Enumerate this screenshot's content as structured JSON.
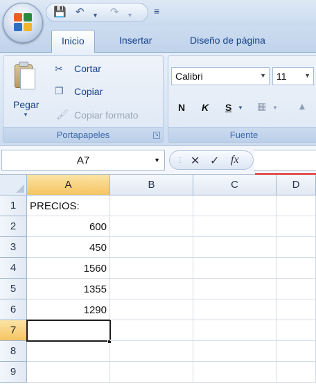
{
  "ribbon_tabs": [
    {
      "label": "Inicio",
      "active": true
    },
    {
      "label": "Insertar",
      "active": false
    },
    {
      "label": "Diseño de página",
      "active": false
    }
  ],
  "clipboard_group": {
    "paste_label": "Pegar",
    "cut_label": "Cortar",
    "copy_label": "Copiar",
    "format_painter_label": "Copiar formato",
    "group_label": "Portapapeles"
  },
  "font_group": {
    "font_name": "Calibri",
    "font_size": "11",
    "bold_label": "N",
    "italic_label": "K",
    "underline_label": "S",
    "group_label": "Fuente"
  },
  "formula_bar": {
    "name_box": "A7",
    "formula": ""
  },
  "sheet": {
    "columns": [
      "A",
      "B",
      "C",
      "D"
    ],
    "selected_column": "A",
    "rows": [
      "1",
      "2",
      "3",
      "4",
      "5",
      "6",
      "7",
      "8",
      "9"
    ],
    "selected_row": "7",
    "cells": {
      "A1": "PRECIOS:",
      "A2": "600",
      "A3": "450",
      "A4": "1560",
      "A5": "1355",
      "A6": "1290"
    }
  },
  "colors": {
    "ribbon_text": "#15428b",
    "selected_header": "#f5c462",
    "accent_line": "#e0242b"
  }
}
